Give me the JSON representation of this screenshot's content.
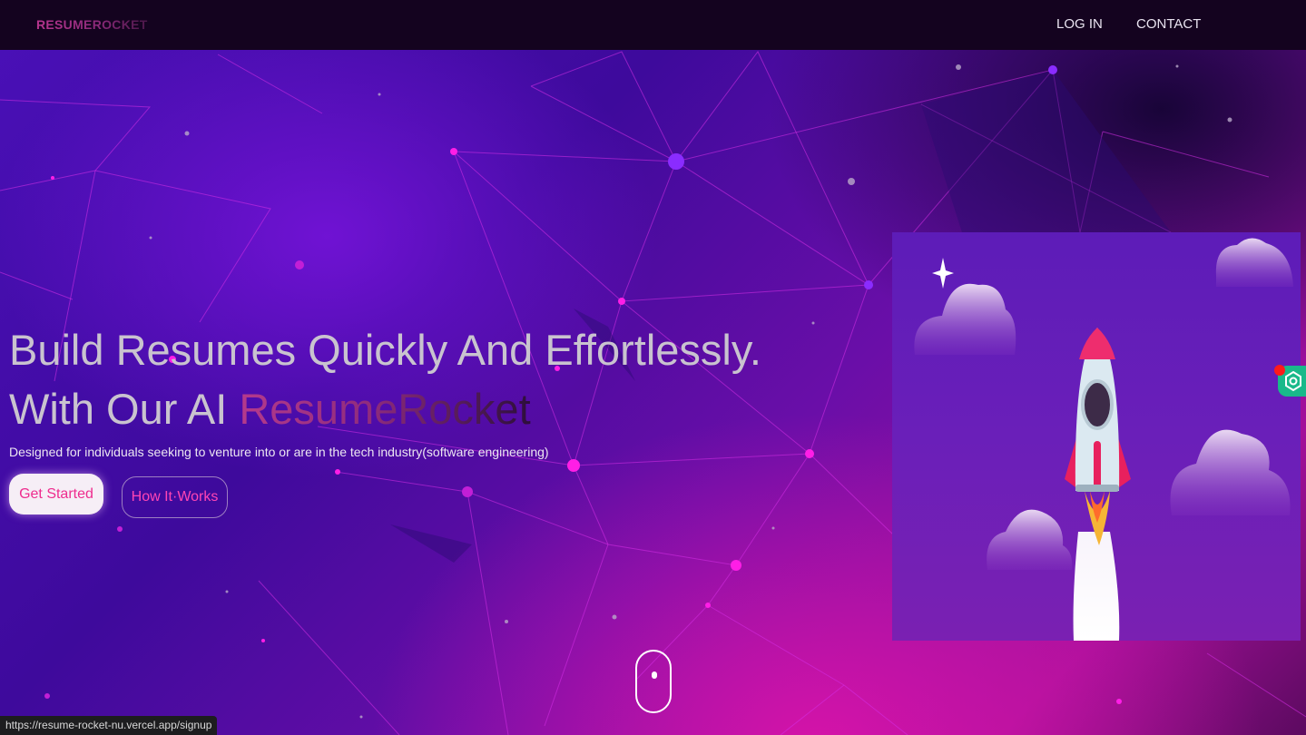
{
  "navbar": {
    "logo": "RESUMEROCKET",
    "links": [
      {
        "label": "LOG IN"
      },
      {
        "label": "CONTACT"
      }
    ]
  },
  "hero": {
    "title_line1": "Build Resumes Quickly And Effortlessly.",
    "title_line2_prefix": "With Our AI ",
    "title_line2_accent": "ResumeRocket",
    "subtitle": "Designed for individuals seeking to venture into or are in the tech industry(software engineering)",
    "primary_button": "Get Started",
    "secondary_button": "How It·Works"
  },
  "hero_image": {
    "icon": "rocket-launch-illustration"
  },
  "scroll_indicator": {
    "icon": "mouse-scroll-icon"
  },
  "extension_widget": {
    "icon": "hexagon-extension-icon"
  },
  "status_bar": {
    "url": "https://resume-rocket-nu.vercel.app/signup"
  },
  "colors": {
    "accent_pink": "#ee2c8e",
    "nav_bg": "#14031f",
    "bg_purple": "#4a10b8",
    "bg_magenta": "#a3109a"
  }
}
